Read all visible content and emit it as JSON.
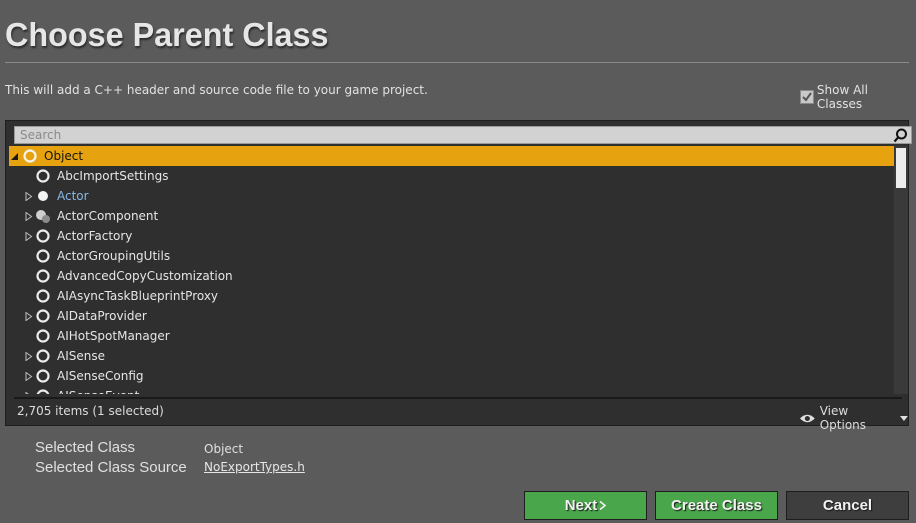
{
  "dialog": {
    "title": "Choose Parent Class",
    "subtitle": "This will add a C++ header and source code file to your game project.",
    "show_all_classes": {
      "label": "Show All Classes",
      "checked": true
    }
  },
  "search": {
    "placeholder": "Search",
    "value": ""
  },
  "tree": {
    "items": [
      {
        "label": "Object",
        "expander": "expanded",
        "icon": "class-circle-icon",
        "selected": true
      },
      {
        "label": "AbcImportSettings",
        "expander": "none",
        "icon": "class-circle-icon"
      },
      {
        "label": "Actor",
        "expander": "collapsed",
        "icon": "actor-sphere-icon"
      },
      {
        "label": "ActorComponent",
        "expander": "collapsed",
        "icon": "actor-component-icon"
      },
      {
        "label": "ActorFactory",
        "expander": "collapsed",
        "icon": "class-circle-icon"
      },
      {
        "label": "ActorGroupingUtils",
        "expander": "none",
        "icon": "class-circle-icon"
      },
      {
        "label": "AdvancedCopyCustomization",
        "expander": "none",
        "icon": "class-circle-icon"
      },
      {
        "label": "AIAsyncTaskBlueprintProxy",
        "expander": "none",
        "icon": "class-circle-icon"
      },
      {
        "label": "AIDataProvider",
        "expander": "collapsed",
        "icon": "class-circle-icon"
      },
      {
        "label": "AIHotSpotManager",
        "expander": "none",
        "icon": "class-circle-icon"
      },
      {
        "label": "AISense",
        "expander": "collapsed",
        "icon": "class-circle-icon"
      },
      {
        "label": "AISenseConfig",
        "expander": "collapsed",
        "icon": "class-circle-icon"
      },
      {
        "label": "AISenseEvent",
        "expander": "collapsed",
        "icon": "class-circle-icon"
      }
    ]
  },
  "footer": {
    "item_count": "2,705 items (1 selected)",
    "view_options": "View Options"
  },
  "selection": {
    "class_label": "Selected Class",
    "class_value": "Object",
    "source_label": "Selected Class Source",
    "source_value": "NoExportTypes.h"
  },
  "buttons": {
    "next": "Next",
    "create": "Create Class",
    "cancel": "Cancel"
  },
  "colors": {
    "selection": "#e6a20f",
    "accent_green": "#4aa64a",
    "actor_text": "#87b7e6"
  }
}
